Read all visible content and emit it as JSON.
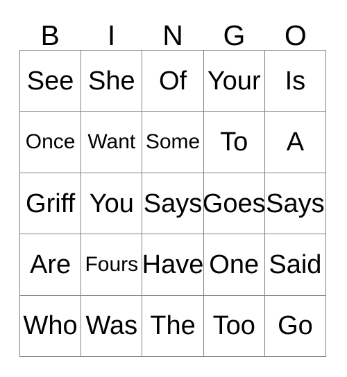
{
  "card": {
    "headers": [
      "B",
      "I",
      "N",
      "G",
      "O"
    ],
    "border_color": "#808080",
    "text_color": "#000000",
    "background_color": "#ffffff",
    "rows": [
      [
        {
          "text": "See",
          "size": "normal"
        },
        {
          "text": "She",
          "size": "normal"
        },
        {
          "text": "Of",
          "size": "normal"
        },
        {
          "text": "Your",
          "size": "normal"
        },
        {
          "text": "Is",
          "size": "normal"
        }
      ],
      [
        {
          "text": "Once",
          "size": "small"
        },
        {
          "text": "Want",
          "size": "small"
        },
        {
          "text": "Some",
          "size": "small"
        },
        {
          "text": "To",
          "size": "normal"
        },
        {
          "text": "A",
          "size": "normal"
        }
      ],
      [
        {
          "text": "Griff",
          "size": "normal"
        },
        {
          "text": "You",
          "size": "normal"
        },
        {
          "text": "Says",
          "size": "normal"
        },
        {
          "text": "Goes",
          "size": "normal"
        },
        {
          "text": "Says",
          "size": "normal"
        }
      ],
      [
        {
          "text": "Are",
          "size": "normal"
        },
        {
          "text": "Fours",
          "size": "small"
        },
        {
          "text": "Have",
          "size": "normal"
        },
        {
          "text": "One",
          "size": "normal"
        },
        {
          "text": "Said",
          "size": "normal"
        }
      ],
      [
        {
          "text": "Who",
          "size": "normal"
        },
        {
          "text": "Was",
          "size": "normal"
        },
        {
          "text": "The",
          "size": "normal"
        },
        {
          "text": "Too",
          "size": "normal"
        },
        {
          "text": "Go",
          "size": "normal"
        }
      ]
    ]
  }
}
